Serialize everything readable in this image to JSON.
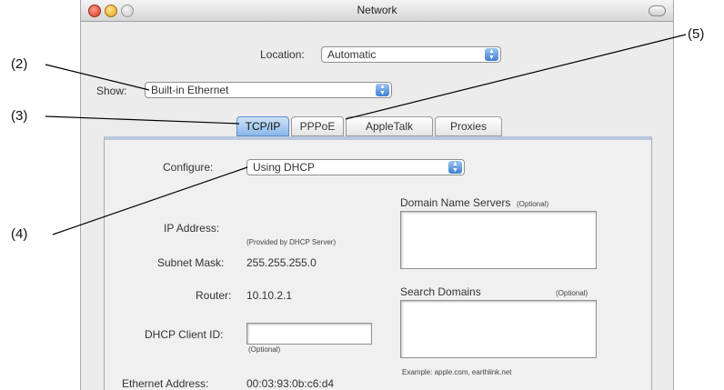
{
  "callouts": [
    "(2)",
    "(3)",
    "(4)",
    "(5)"
  ],
  "window": {
    "title": "Network"
  },
  "location": {
    "label": "Location:",
    "value": "Automatic"
  },
  "show": {
    "label": "Show:",
    "value": "Built-in Ethernet"
  },
  "tabs": [
    "TCP/IP",
    "PPPoE",
    "AppleTalk",
    "Proxies"
  ],
  "configure": {
    "label": "Configure:",
    "value": "Using DHCP"
  },
  "ip_address": {
    "label": "IP Address:",
    "note": "(Provided by DHCP Server)"
  },
  "subnet": {
    "label": "Subnet Mask:",
    "value": "255.255.255.0"
  },
  "router": {
    "label": "Router:",
    "value": "10.10.2.1"
  },
  "dhcp_client": {
    "label": "DHCP Client ID:",
    "note": "(Optional)"
  },
  "ethernet": {
    "label": "Ethernet Address:",
    "value": "00:03:93:0b:c6:d4"
  },
  "dns": {
    "label": "Domain Name Servers",
    "note": "(Optional)"
  },
  "search": {
    "label": "Search Domains",
    "note": "(Optional)",
    "example": "Example: apple.com, earthlink.net"
  }
}
